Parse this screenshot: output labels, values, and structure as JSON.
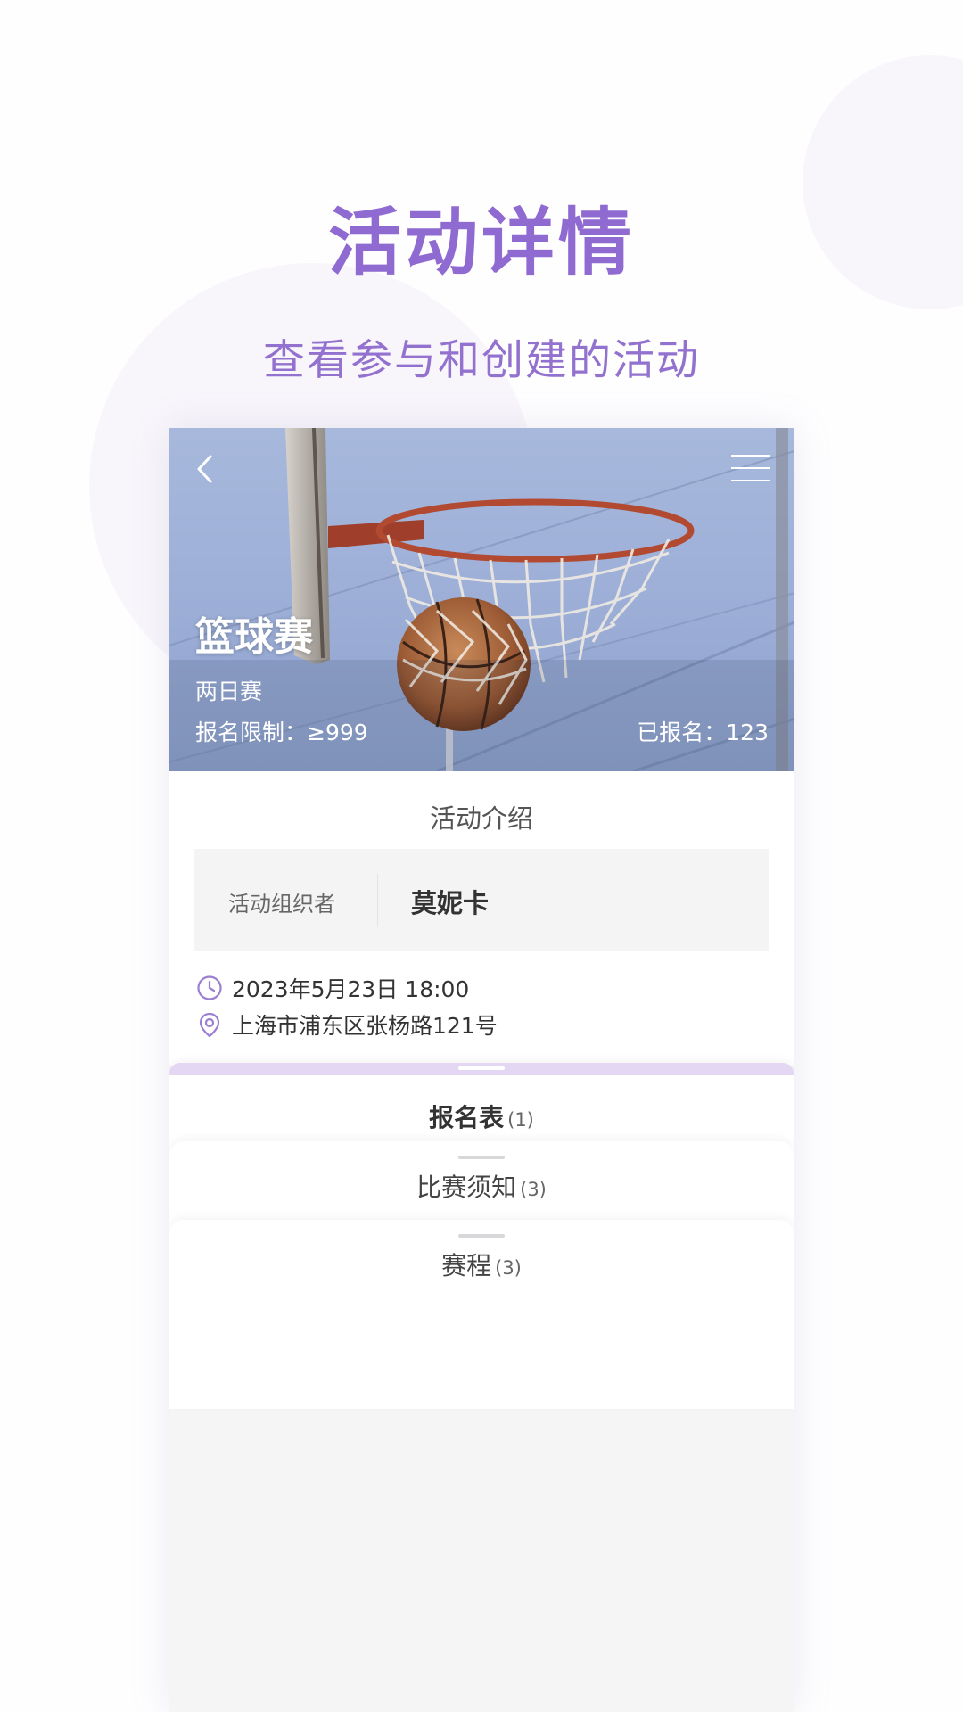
{
  "hero": {
    "title": "活动详情",
    "subtitle": "查看参与和创建的活动"
  },
  "banner": {
    "back_icon": "chevron-left-icon",
    "menu_icon": "hamburger-menu-icon",
    "event_title": "篮球赛",
    "event_type": "两日赛",
    "limit_text": "报名限制：≥999",
    "count_text": "已报名：123"
  },
  "intro": {
    "section_title": "活动介绍",
    "organizer_label": "活动组织者",
    "organizer_name": "莫妮卡",
    "datetime": "2023年5月23日 18:00",
    "address": "上海市浦东区张杨路121号"
  },
  "tabs": [
    {
      "label": "报名表",
      "count": "(1)",
      "active": true
    },
    {
      "label": "比赛须知",
      "count": "(3)",
      "active": false
    },
    {
      "label": "赛程",
      "count": "(3)",
      "active": false
    }
  ],
  "colors": {
    "accent": "#8f6ad1",
    "tab_strip": "#e3d7f4"
  }
}
